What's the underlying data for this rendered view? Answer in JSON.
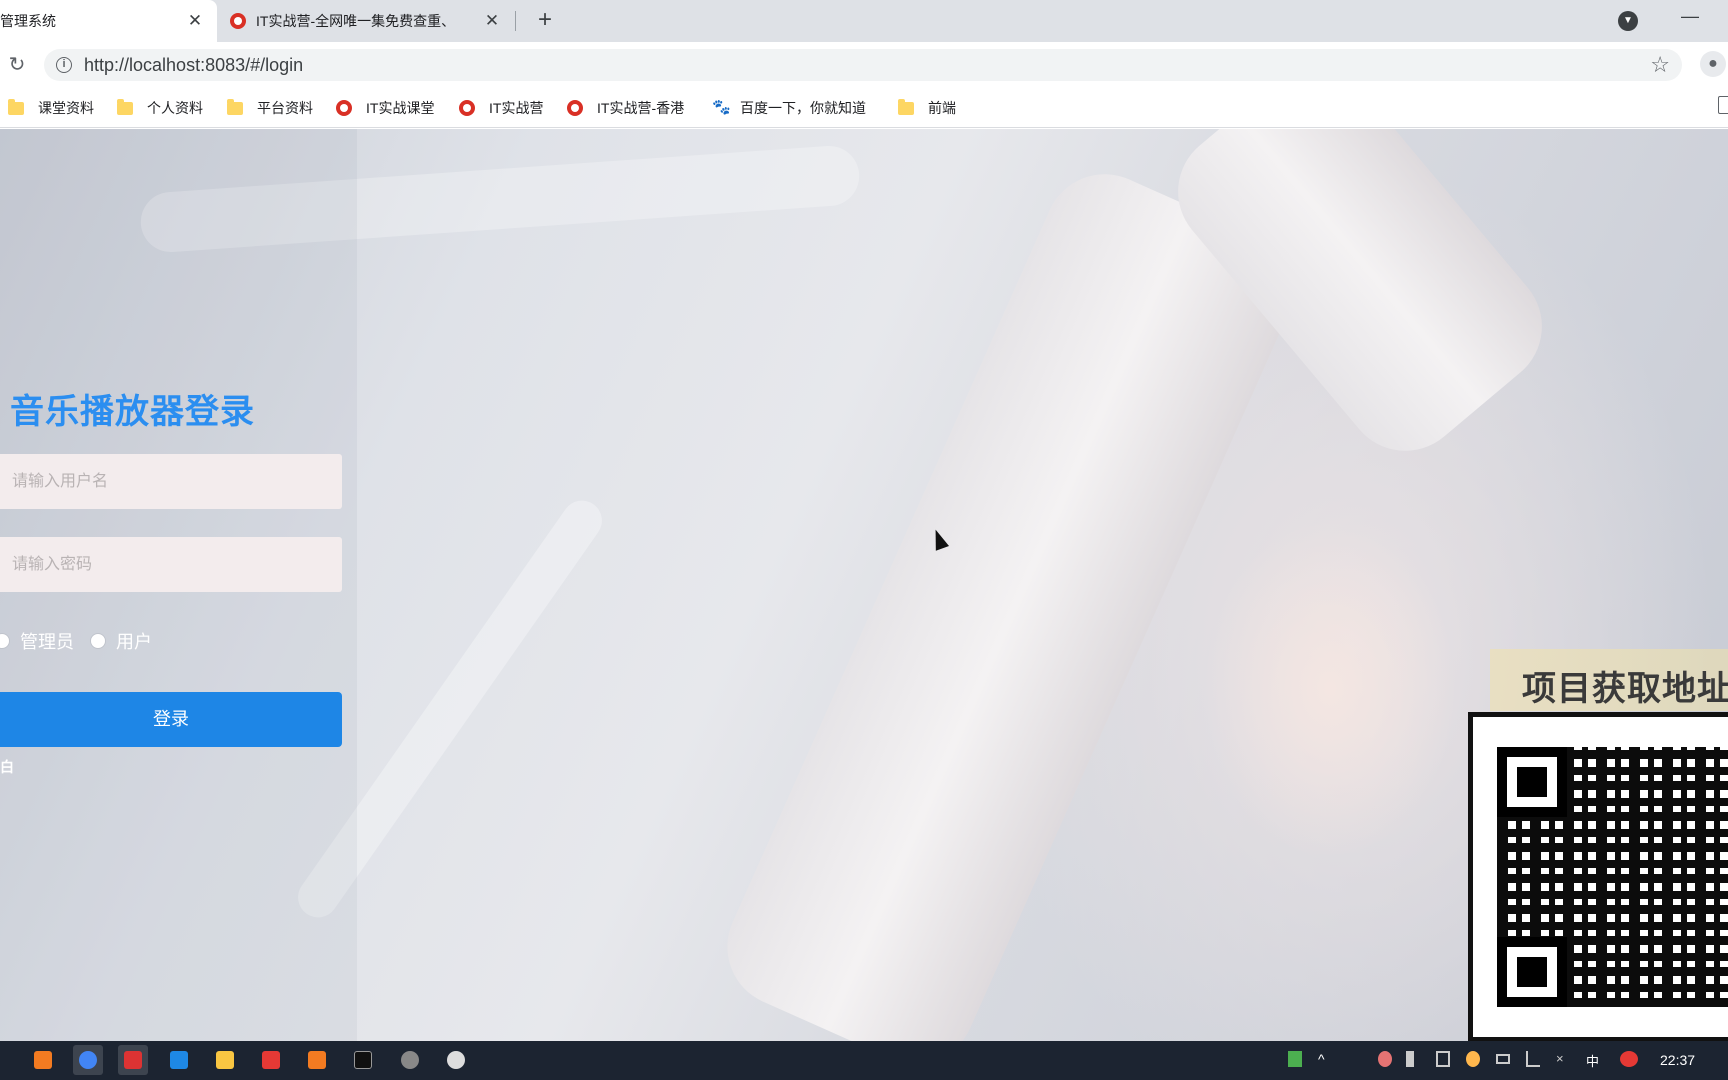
{
  "browser": {
    "tabs": [
      {
        "title": "管理系统",
        "active": true
      },
      {
        "title": "IT实战营-全网唯一集免费查重、",
        "active": false
      }
    ],
    "url": "http://localhost:8083/#/login",
    "bookmarks": [
      {
        "label": "课堂资料",
        "icon": "folder-icon"
      },
      {
        "label": "个人资料",
        "icon": "folder-icon"
      },
      {
        "label": "平台资料",
        "icon": "folder-icon"
      },
      {
        "label": "IT实战课堂",
        "icon": "site-icon"
      },
      {
        "label": "IT实战营",
        "icon": "site-icon"
      },
      {
        "label": "IT实战营-香港",
        "icon": "site-icon"
      },
      {
        "label": "百度一下，你就知道",
        "icon": "baidu-paw-icon"
      },
      {
        "label": "前端",
        "icon": "folder-icon"
      }
    ]
  },
  "login": {
    "title": "音乐播放器登录",
    "username_placeholder": "请输入用户名",
    "password_placeholder": "请输入密码",
    "roles": [
      "管理员",
      "用户"
    ],
    "submit_label": "登录",
    "edge_glyph": "白"
  },
  "promo": {
    "label": "项目获取地址"
  },
  "taskbar": {
    "time": "22:37"
  },
  "colors": {
    "accent": "#1e86e6",
    "title": "#2b8ef0"
  }
}
